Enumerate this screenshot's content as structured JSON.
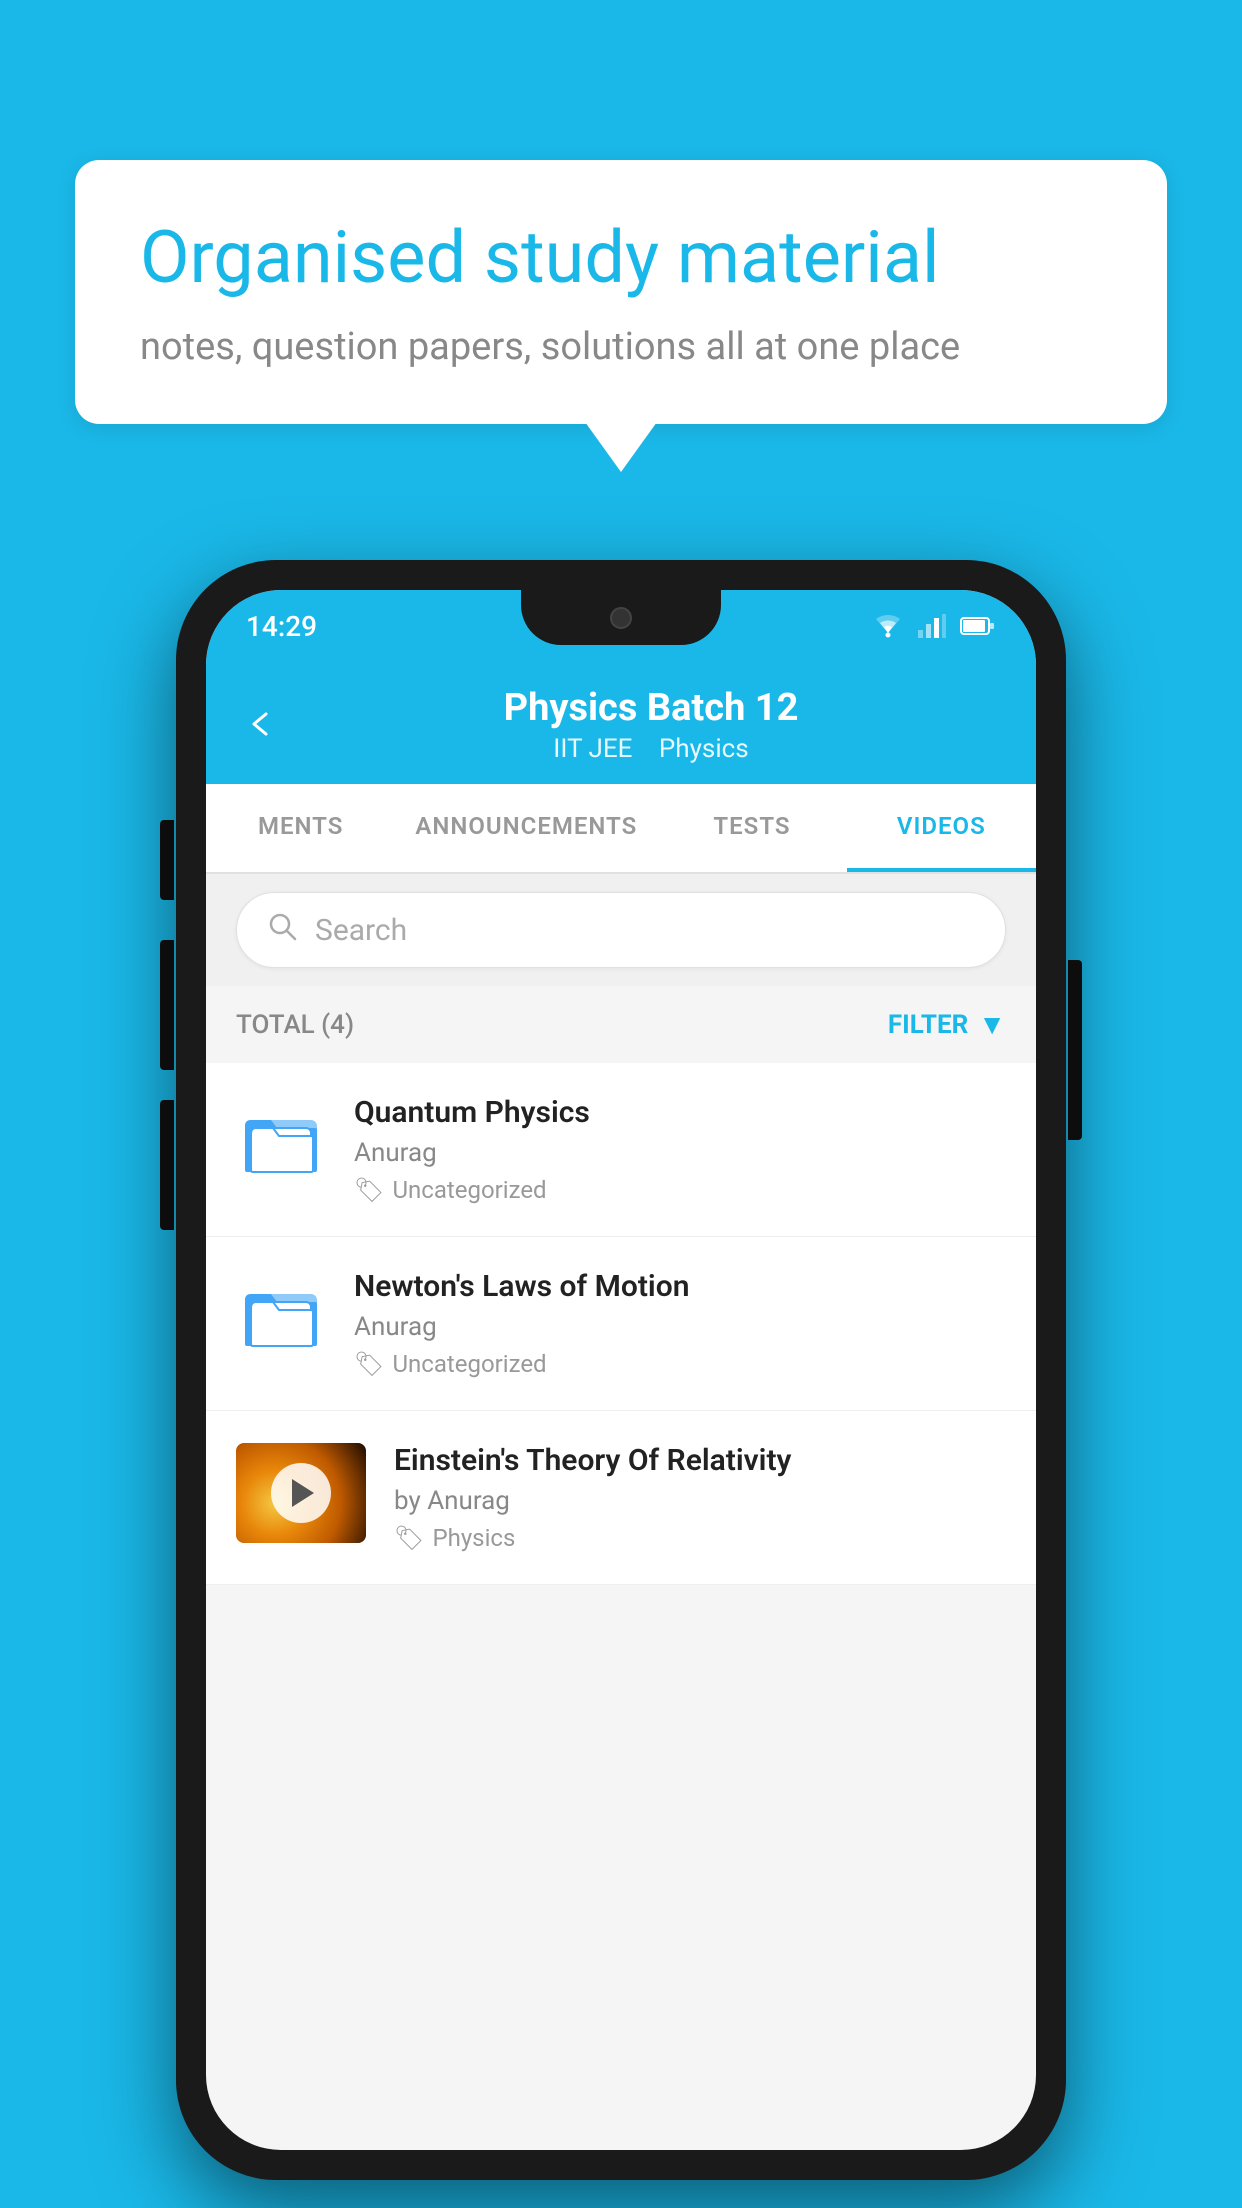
{
  "page": {
    "background_color": "#1ab8e8"
  },
  "speech_bubble": {
    "title": "Organised study material",
    "subtitle": "notes, question papers, solutions all at one place"
  },
  "status_bar": {
    "time": "14:29"
  },
  "header": {
    "title": "Physics Batch 12",
    "subtitle1": "IIT JEE",
    "subtitle2": "Physics"
  },
  "tabs": [
    {
      "label": "MENTS",
      "active": false
    },
    {
      "label": "ANNOUNCEMENTS",
      "active": false
    },
    {
      "label": "TESTS",
      "active": false
    },
    {
      "label": "VIDEOS",
      "active": true
    }
  ],
  "search": {
    "placeholder": "Search"
  },
  "filter": {
    "total_label": "TOTAL (4)",
    "filter_label": "FILTER"
  },
  "videos": [
    {
      "id": 1,
      "title": "Quantum Physics",
      "author": "Anurag",
      "tag": "Uncategorized",
      "type": "folder",
      "has_thumb": false
    },
    {
      "id": 2,
      "title": "Newton's Laws of Motion",
      "author": "Anurag",
      "tag": "Uncategorized",
      "type": "folder",
      "has_thumb": false
    },
    {
      "id": 3,
      "title": "Einstein's Theory Of Relativity",
      "author": "by Anurag",
      "tag": "Physics",
      "type": "video",
      "has_thumb": true
    }
  ]
}
